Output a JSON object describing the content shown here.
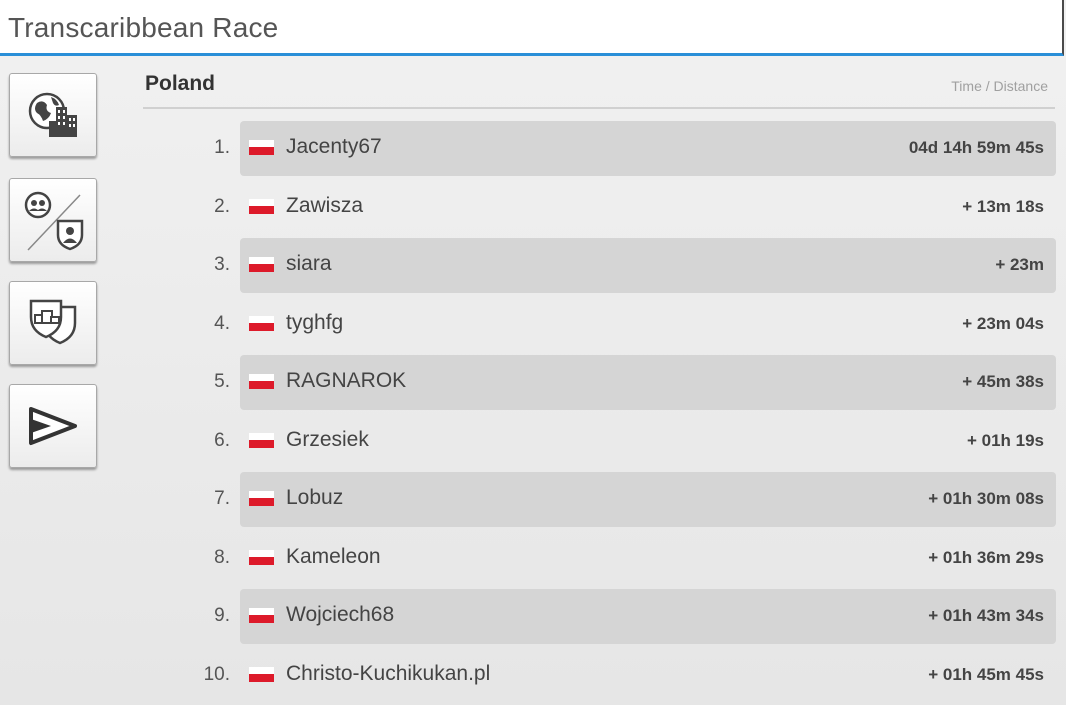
{
  "window": {
    "title": "Transcaribbean Race"
  },
  "sidebar": {
    "buttons": [
      {
        "name": "world-ranking",
        "icon": "globe-city-icon"
      },
      {
        "name": "group-vs-team",
        "icon": "group-team-icon"
      },
      {
        "name": "team-ranking",
        "icon": "team-shield-icon"
      },
      {
        "name": "race-ranking",
        "icon": "flag-arrow-icon"
      }
    ]
  },
  "leaderboard": {
    "country": "Poland",
    "column_label": "Time / Distance",
    "flag_colors": {
      "top": "#ffffff",
      "bottom": "#dd1a2a"
    },
    "rows": [
      {
        "rank": "1.",
        "name": "Jacenty67",
        "time": "04d 14h 59m 45s"
      },
      {
        "rank": "2.",
        "name": "Zawisza",
        "time": "+ 13m 18s"
      },
      {
        "rank": "3.",
        "name": "siara",
        "time": "+ 23m"
      },
      {
        "rank": "4.",
        "name": "tyghfg",
        "time": "+ 23m 04s"
      },
      {
        "rank": "5.",
        "name": "RAGNAROK",
        "time": "+ 45m 38s"
      },
      {
        "rank": "6.",
        "name": "Grzesiek",
        "time": "+ 01h 19s"
      },
      {
        "rank": "7.",
        "name": "Lobuz",
        "time": "+ 01h 30m 08s"
      },
      {
        "rank": "8.",
        "name": "Kameleon",
        "time": "+ 01h 36m 29s"
      },
      {
        "rank": "9.",
        "name": "Wojciech68",
        "time": "+ 01h 43m 34s"
      },
      {
        "rank": "10.",
        "name": "Christo-Kuchikukan.pl",
        "time": "+ 01h 45m 45s"
      }
    ]
  }
}
